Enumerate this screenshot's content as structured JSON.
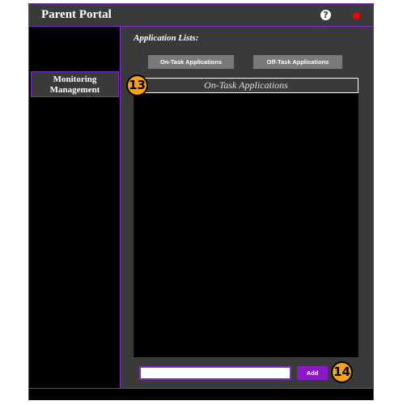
{
  "window": {
    "title": "Parent Portal",
    "help_icon": "?",
    "close_icon": "close-icon"
  },
  "sidebar": {
    "items": [
      {
        "label": "Monitoring Management"
      }
    ]
  },
  "main": {
    "section_label": "Application Lists:",
    "tabs": [
      {
        "label": "On-Task Applications"
      },
      {
        "label": "Off-Task Applications"
      }
    ],
    "list_header": "On-Task Applications",
    "add_input": {
      "value": "",
      "placeholder": ""
    },
    "add_button_label": "Add"
  },
  "annotations": {
    "badge_13": "13",
    "badge_14": "14"
  },
  "colors": {
    "accent": "#7b2fbe",
    "add_button": "#8a18c6",
    "close": "#ff0000",
    "badge": "#f4a21d"
  }
}
